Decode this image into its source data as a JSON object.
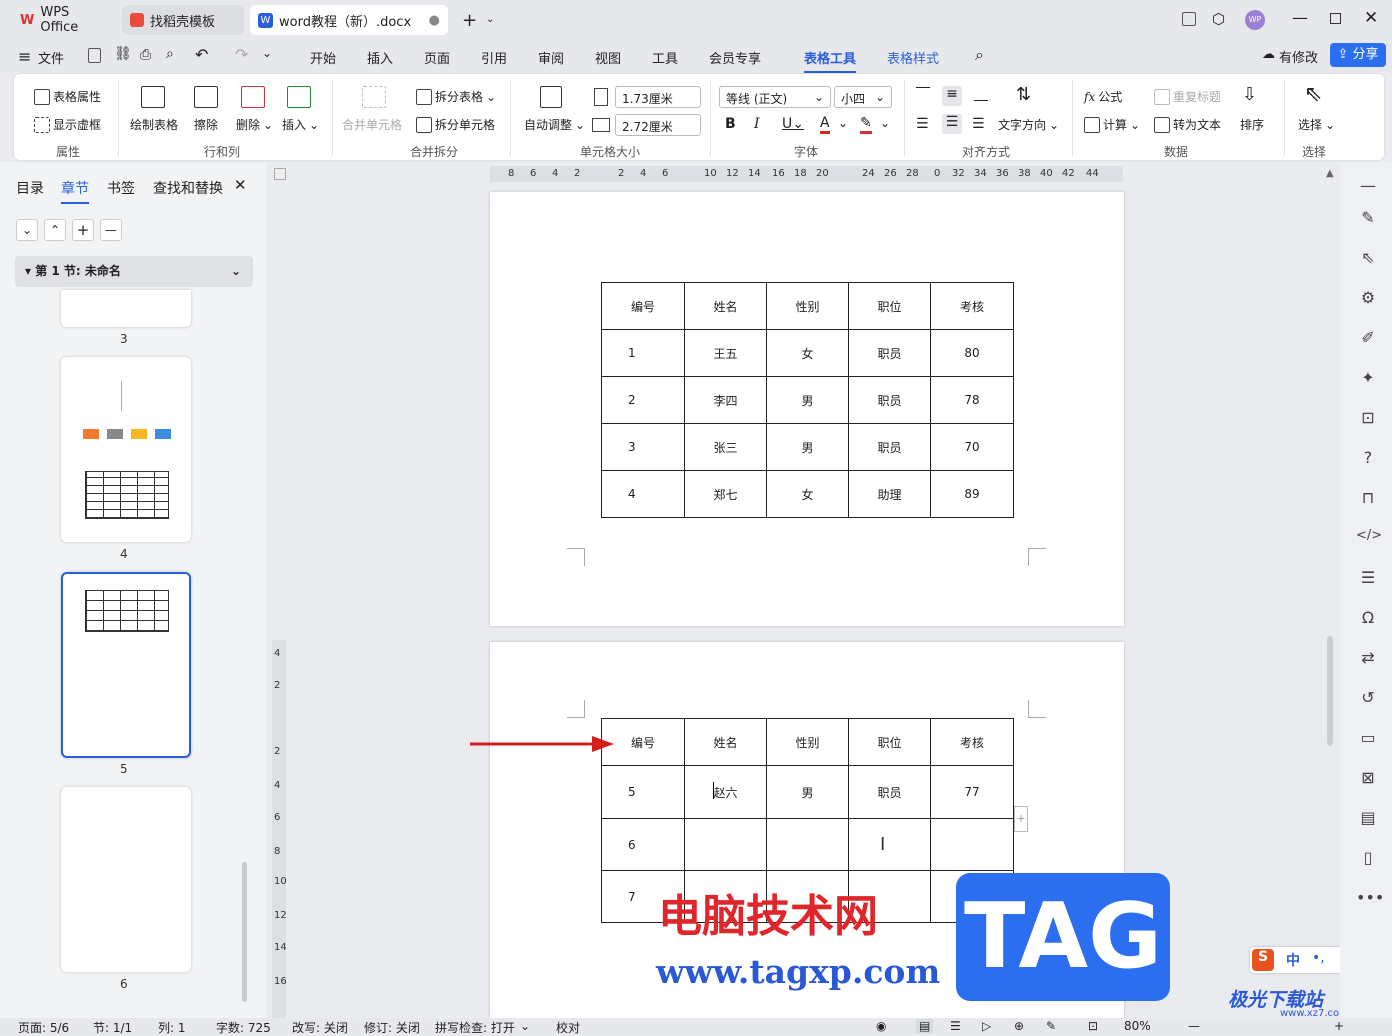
{
  "tabs": [
    {
      "label": "WPS Office"
    },
    {
      "label": "找稻壳模板"
    },
    {
      "label": "word教程（新）.docx"
    }
  ],
  "menu": {
    "file": "文件",
    "items": [
      "开始",
      "插入",
      "页面",
      "引用",
      "审阅",
      "视图",
      "工具",
      "会员专享",
      "表格工具",
      "表格样式"
    ],
    "active": "表格工具",
    "modified": "有修改",
    "share": "分享"
  },
  "ribbon": {
    "props": {
      "table_props": "表格属性",
      "show_grid": "显示虚框",
      "group": "属性"
    },
    "rowcol": {
      "draw": "绘制表格",
      "erase": "擦除",
      "delete": "删除",
      "insert": "插入",
      "group": "行和列"
    },
    "merge": {
      "merge_cells": "合并单元格",
      "split_table": "拆分表格",
      "split_cells": "拆分单元格",
      "group": "合并拆分"
    },
    "size": {
      "auto": "自动调整",
      "height": "1.73厘米",
      "width": "2.72厘米",
      "group": "单元格大小"
    },
    "font": {
      "name": "等线 (正文)",
      "size": "小四",
      "group": "字体"
    },
    "align": {
      "direction": "文字方向",
      "group": "对齐方式"
    },
    "data": {
      "formula": "公式",
      "repeat_title": "重复标题",
      "calc": "计算",
      "to_text": "转为文本",
      "sort": "排序",
      "group": "数据"
    },
    "select": {
      "label": "选择",
      "group": "选择"
    }
  },
  "nav": {
    "tabs": [
      "目录",
      "章节",
      "书签",
      "查找和替换"
    ],
    "active": "章节",
    "section": "第 1 节: 未命名",
    "pages": [
      "3",
      "4",
      "5",
      "6"
    ]
  },
  "ruler": {
    "top": [
      "8",
      "6",
      "4",
      "2",
      "2",
      "4",
      "6",
      "10",
      "12",
      "14",
      "16",
      "18",
      "20",
      "24",
      "26",
      "28",
      "0",
      "32",
      "34",
      "36",
      "38",
      "40",
      "42",
      "44"
    ],
    "left": [
      "4",
      "2",
      "2",
      "4",
      "6",
      "8",
      "10",
      "12",
      "14",
      "16"
    ]
  },
  "table1": {
    "header": [
      "编号",
      "姓名",
      "性别",
      "职位",
      "考核"
    ],
    "rows": [
      [
        "1",
        "王五",
        "女",
        "职员",
        "80"
      ],
      [
        "2",
        "李四",
        "男",
        "职员",
        "78"
      ],
      [
        "3",
        "张三",
        "男",
        "职员",
        "70"
      ],
      [
        "4",
        "郑七",
        "女",
        "助理",
        "89"
      ]
    ]
  },
  "table2": {
    "header": [
      "编号",
      "姓名",
      "性别",
      "职位",
      "考核"
    ],
    "rows": [
      [
        "5",
        "赵六",
        "男",
        "职员",
        "77"
      ],
      [
        "6",
        "",
        "",
        "",
        ""
      ],
      [
        "7",
        "",
        "",
        "",
        ""
      ]
    ]
  },
  "watermark": {
    "cn": "电脑技术网",
    "url": "www.tagxp.com",
    "tag": "TAG",
    "site": "极光下载站",
    "site_url": "www.xz7.com",
    "ime": "中"
  },
  "status": {
    "page": "页面: 5/6",
    "section": "节: 1/1",
    "col": "列: 1",
    "words": "字数: 725",
    "rewrite": "改写: 关闭",
    "revise": "修订: 关闭",
    "spell": "拼写检查: 打开",
    "proof": "校对",
    "zoom": "80%"
  }
}
